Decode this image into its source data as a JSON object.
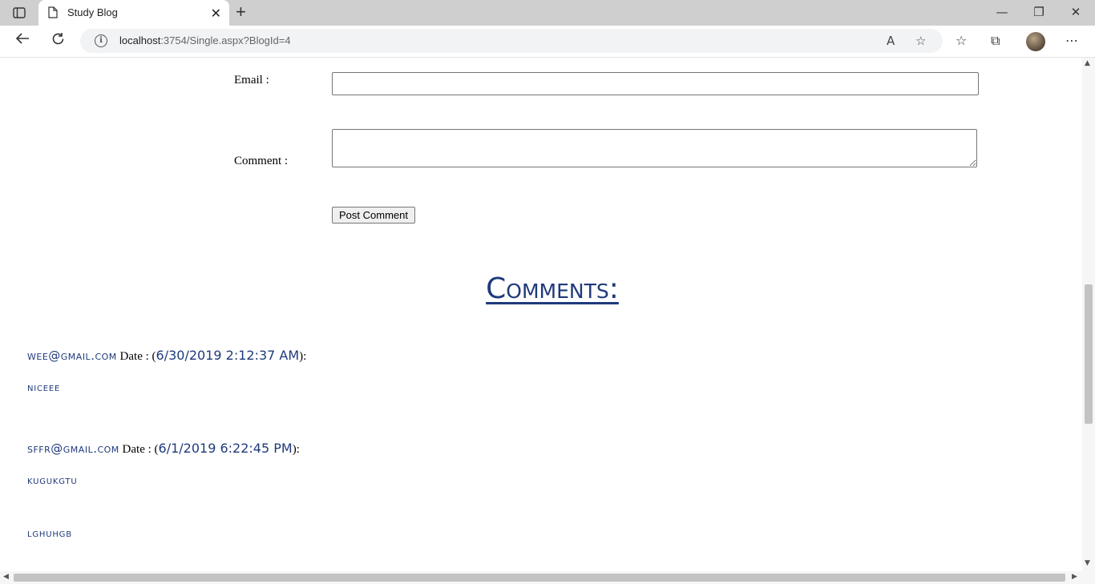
{
  "browser": {
    "tab_title": "Study Blog",
    "tab_close": "✕",
    "new_tab": "+",
    "url_host": "localhost",
    "url_rest": ":3754/Single.aspx?BlogId=4",
    "window_controls": {
      "minimize": "—",
      "restore": "❐",
      "close": "✕"
    },
    "icons": [
      "tab-actions-icon",
      "page-icon",
      "back-icon",
      "reload-icon",
      "info-icon",
      "read-aloud-icon",
      "add-favorite-icon",
      "favorites-icon",
      "collections-icon",
      "profile-avatar",
      "more-icon"
    ]
  },
  "form": {
    "email_label": "Email :",
    "email_value": "",
    "comment_label": "Comment :",
    "comment_value": "",
    "submit_label": "Post Comment"
  },
  "comments": {
    "heading": "Comments:",
    "items": [
      {
        "email": "wee@gmail.com",
        "date_prefix": "Date : (",
        "date": "6/30/2019 2:12:37 AM",
        "date_suffix": "):",
        "text": "niceee"
      },
      {
        "email": "sffr@gmail.com",
        "date_prefix": "Date : (",
        "date": "6/1/2019 6:22:45 PM",
        "date_suffix": "):",
        "text": "kugukgtu"
      }
    ],
    "trailing_text": "lghuhgb"
  },
  "colors": {
    "accent": "#1f3a7a",
    "tabbar": "#cfcfcf"
  }
}
